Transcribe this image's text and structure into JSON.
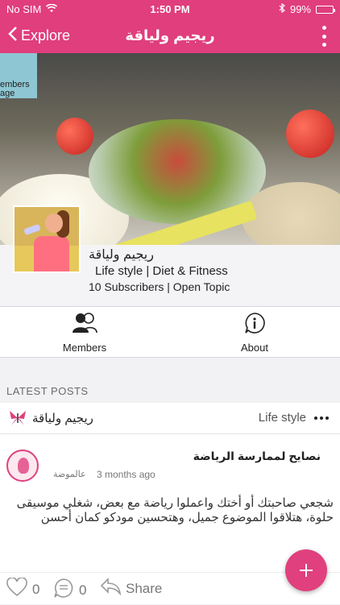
{
  "status_bar": {
    "carrier": "No SIM",
    "time": "1:50 PM",
    "battery": "99%",
    "battery_level": 0.99
  },
  "nav": {
    "back_label": "Explore",
    "title": "ريجيم ولياقة"
  },
  "cover": {
    "badge_text_line1": "embers",
    "badge_text_line2": "age"
  },
  "group": {
    "name": "ريجيم ولياقة",
    "category": "Life style | Diet & Fitness",
    "meta": "10 Subscribers | Open Topic"
  },
  "tabs": [
    {
      "label": "Members",
      "icon": "members-icon"
    },
    {
      "label": "About",
      "icon": "about-icon"
    }
  ],
  "section": {
    "latest_posts": "LATEST POSTS"
  },
  "post": {
    "topic_name": "ريجيم ولياقة",
    "topic_category": "Life style",
    "title": "نصايح لممارسة الرياضة",
    "time": "3 months ago",
    "author": "عالموضة",
    "body": "شجعي صاحبتك أو أختك واعملوا رياضة مع بعض، شغلي موسيقى حلوة، هتلاقوا الموضوع جميل، وهتحسين مودكو كمان أحسن",
    "likes": "0",
    "comments": "0",
    "share_label": "Share"
  },
  "colors": {
    "brand": "#e03e7d",
    "battery_fill": "#7ddc3a"
  }
}
